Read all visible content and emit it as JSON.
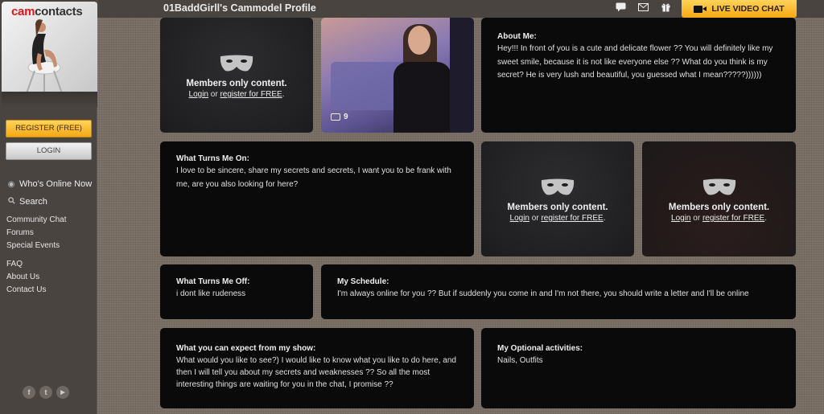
{
  "brand": {
    "part1": "cam",
    "part2": "contacts"
  },
  "sidebar": {
    "register_label": "REGISTER (FREE)",
    "login_label": "LOGIN",
    "main_nav": [
      {
        "label": "Who's Online Now",
        "icon": "webcam-icon"
      },
      {
        "label": "Search",
        "icon": "search-icon"
      }
    ],
    "group1": [
      "Community Chat",
      "Forums",
      "Special Events"
    ],
    "group2": [
      "FAQ",
      "About Us",
      "Contact Us"
    ],
    "social": [
      {
        "name": "facebook",
        "glyph": "f"
      },
      {
        "name": "twitter",
        "glyph": "t"
      },
      {
        "name": "youtube",
        "glyph": "▶"
      }
    ]
  },
  "header": {
    "title": "01BaddGirll's Cammodel Profile",
    "icons": [
      "chat-icon",
      "mail-icon",
      "gift-icon"
    ],
    "live_chat_label": "LIVE VIDEO CHAT"
  },
  "locked": {
    "message": "Members only content.",
    "login_link": "Login",
    "or_text": " or ",
    "register_link": "register for FREE",
    "suffix": "."
  },
  "photo": {
    "count": "9"
  },
  "sections": {
    "about": {
      "title": "About Me:",
      "body": "Hey!!! In front of you is a cute and delicate flower ?? You will definitely like my sweet smile, because it is not like everyone else ?? What do you think is my secret? He is very lush and beautiful, you guessed what I mean?????))))))"
    },
    "turns_on": {
      "title": "What Turns Me On:",
      "body": "I love to be sincere, share my secrets and secrets, I want you to be frank with me, are you also looking for here?"
    },
    "turns_off": {
      "title": "What Turns Me Off:",
      "body": "i dont like rudeness"
    },
    "schedule": {
      "title": "My Schedule:",
      "body": "I'm always online for you ?? But if suddenly you come in and I'm not there, you should write a letter and I'll be online"
    },
    "expect": {
      "title": "What you can expect from my show:",
      "body": "What would you like to see?) I would like to know what you like to do here, and then I will tell you about my secrets and weaknesses ?? So all the most interesting things are waiting for you in the chat, I promise ??"
    },
    "optional": {
      "title": "My Optional activities:",
      "body": "Nails, Outfits"
    }
  }
}
